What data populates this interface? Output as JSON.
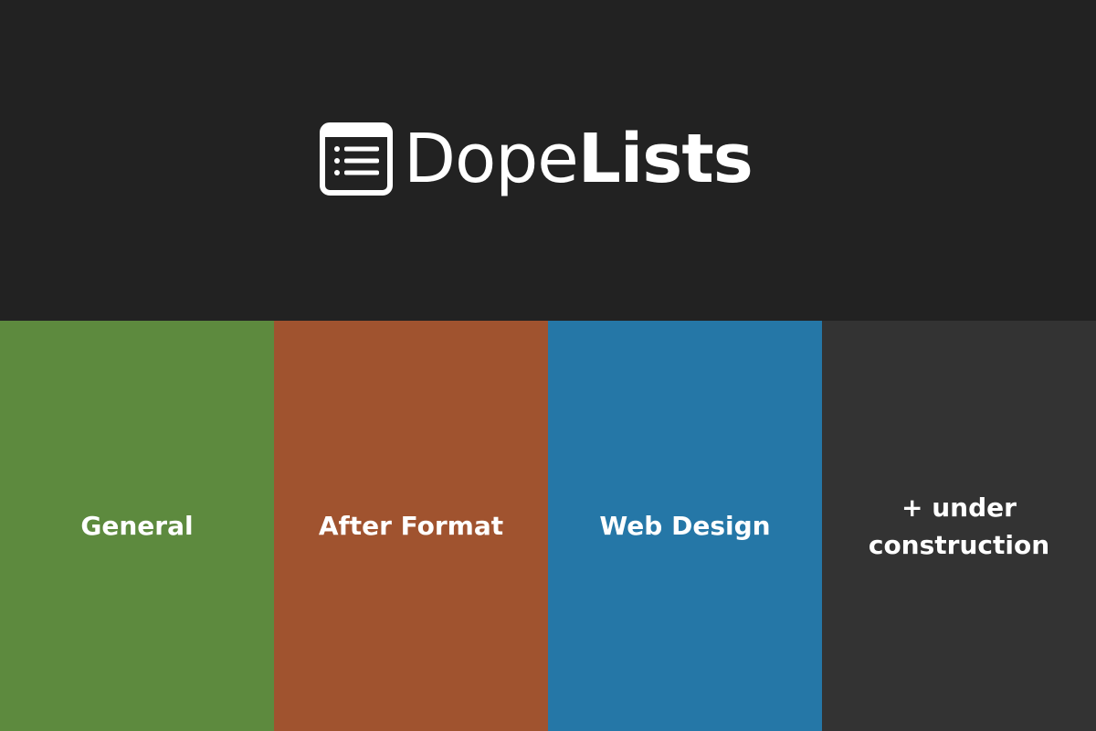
{
  "header": {
    "logo_icon": "list-icon",
    "logo_text_light": "Dope",
    "logo_text_bold": "Lists"
  },
  "tiles": [
    {
      "label": "General",
      "color": "#5d8a3e"
    },
    {
      "label": "After Format",
      "color": "#a0532f"
    },
    {
      "label": "Web Design",
      "color": "#2577a7"
    },
    {
      "label": "+ under construction",
      "color": "#333333"
    }
  ],
  "colors": {
    "header_background": "#222222",
    "text": "#ffffff"
  }
}
